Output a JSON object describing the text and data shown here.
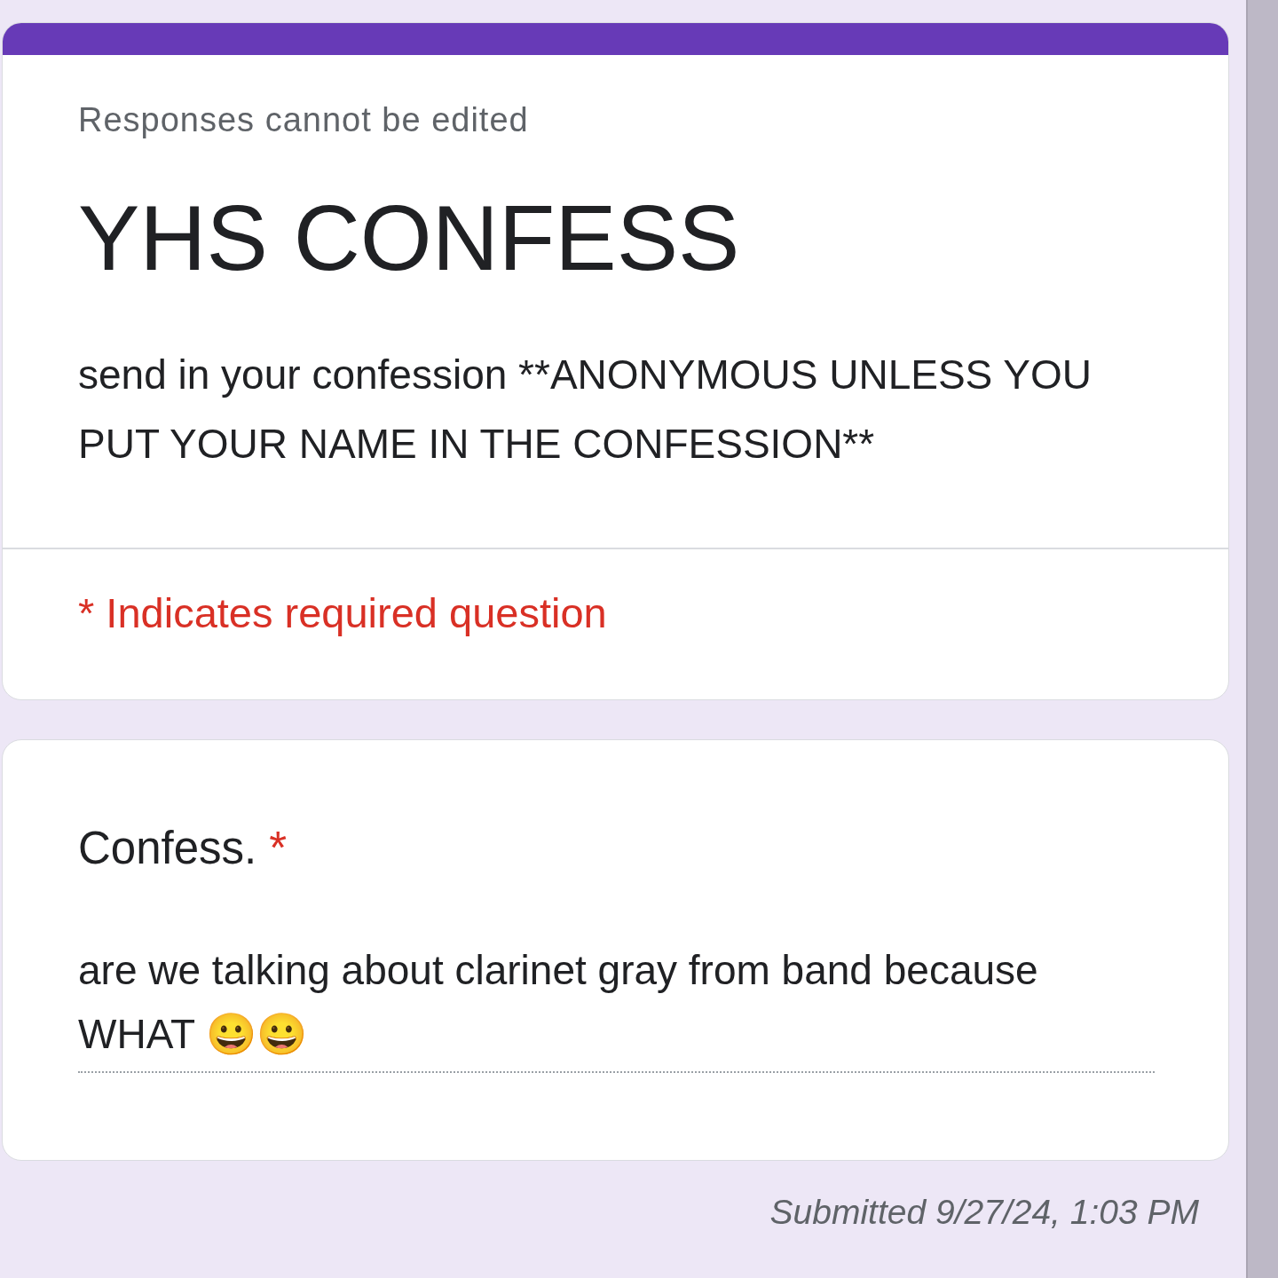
{
  "header": {
    "notice": "Responses cannot be edited",
    "title": "YHS CONFESS",
    "description": "send in your confession **ANONYMOUS UNLESS YOU PUT YOUR NAME IN THE CONFESSION**",
    "required_note": "* Indicates required question"
  },
  "questions": [
    {
      "title": "Confess.",
      "required": true,
      "required_mark": "*",
      "answer": "are we talking about clarinet gray from band because WHAT 😀😀"
    }
  ],
  "footer": {
    "submitted": "Submitted 9/27/24, 1:03 PM"
  }
}
